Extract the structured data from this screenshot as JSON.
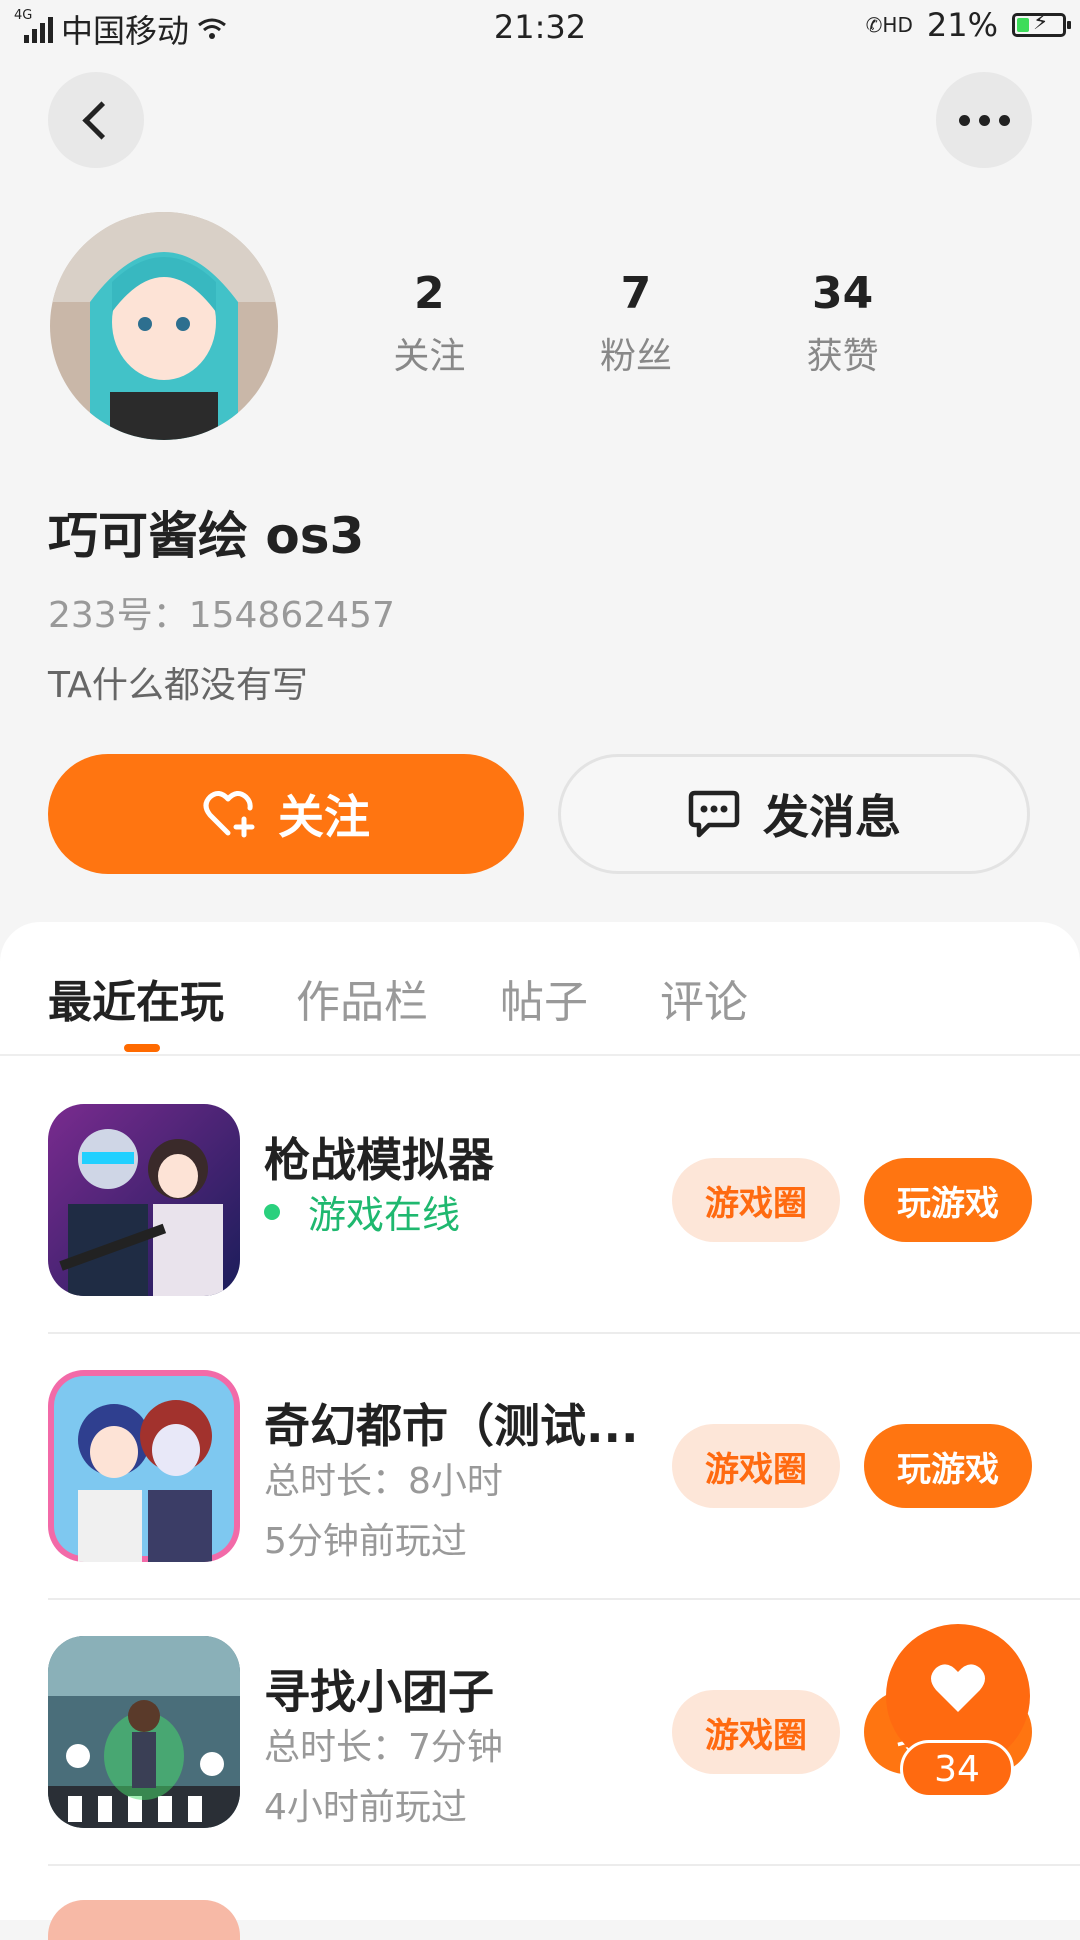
{
  "status_bar": {
    "network": "4G",
    "carrier": "中国移动",
    "time": "21:32",
    "call_hd": "HD",
    "battery": "21%"
  },
  "nav": {
    "back_icon": "chevron-left-icon",
    "more_icon": "more-dots-icon"
  },
  "profile": {
    "stats": [
      {
        "value": "2",
        "label": "关注"
      },
      {
        "value": "7",
        "label": "粉丝"
      },
      {
        "value": "34",
        "label": "获赞"
      }
    ],
    "name": "巧可酱绘 os3",
    "id_text": "233号：154862457",
    "bio": "TA什么都没有写"
  },
  "actions": {
    "follow": "关注",
    "message": "发消息"
  },
  "tabs": [
    "最近在玩",
    "作品栏",
    "帖子",
    "评论"
  ],
  "games": [
    {
      "title": "枪战模拟器",
      "online": "游戏在线",
      "circle": "游戏圈",
      "play": "玩游戏"
    },
    {
      "title": "奇幻都市（测试...",
      "duration": "总时长：8小时",
      "last_played": "5分钟前玩过",
      "circle": "游戏圈",
      "play": "玩游戏"
    },
    {
      "title": "寻找小团子",
      "duration": "总时长：7分钟",
      "last_played": "4小时前玩过",
      "circle": "游戏圈",
      "play": "玩游戏"
    }
  ],
  "like_fab": {
    "count": "34"
  },
  "colors": {
    "accent": "#ff7511",
    "online": "#1fb86f",
    "pill_light": "#fde6d8"
  }
}
